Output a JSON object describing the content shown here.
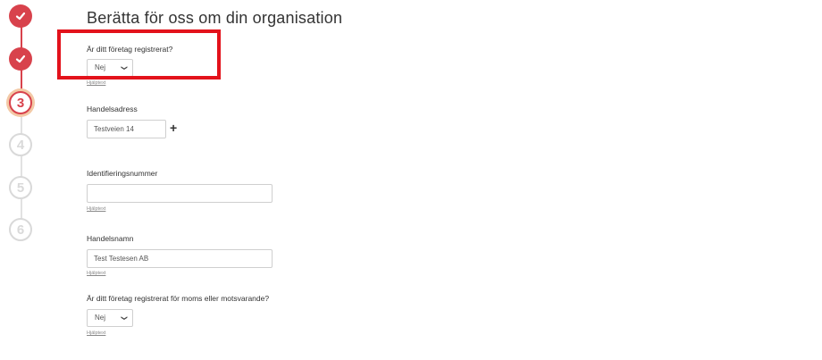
{
  "stepper": {
    "steps": [
      {
        "label": "",
        "state": "done"
      },
      {
        "label": "",
        "state": "done"
      },
      {
        "label": "3",
        "state": "active"
      },
      {
        "label": "4",
        "state": "todo"
      },
      {
        "label": "5",
        "state": "todo"
      },
      {
        "label": "6",
        "state": "todo"
      }
    ]
  },
  "title": "Berätta för oss om din organisation",
  "fields": {
    "registered": {
      "label": "Är ditt företag registrerat?",
      "value": "Nej",
      "help": "Hjälptext"
    },
    "trade_address": {
      "label": "Handelsadress",
      "value": "Testveien 14"
    },
    "id_number": {
      "label": "Identifieringsnummer",
      "value": "",
      "help": "Hjälptext"
    },
    "trade_name": {
      "label": "Handelsnamn",
      "value": "Test Testesen AB",
      "help": "Hjälptext"
    },
    "vat_registered": {
      "label": "Är ditt företag registrerat för moms eller motsvarande?",
      "value": "Nej",
      "help": "Hjälptext"
    }
  },
  "colors": {
    "accent": "#d8424c",
    "highlight": "#e3121b",
    "inactive": "#d9d9d9"
  }
}
